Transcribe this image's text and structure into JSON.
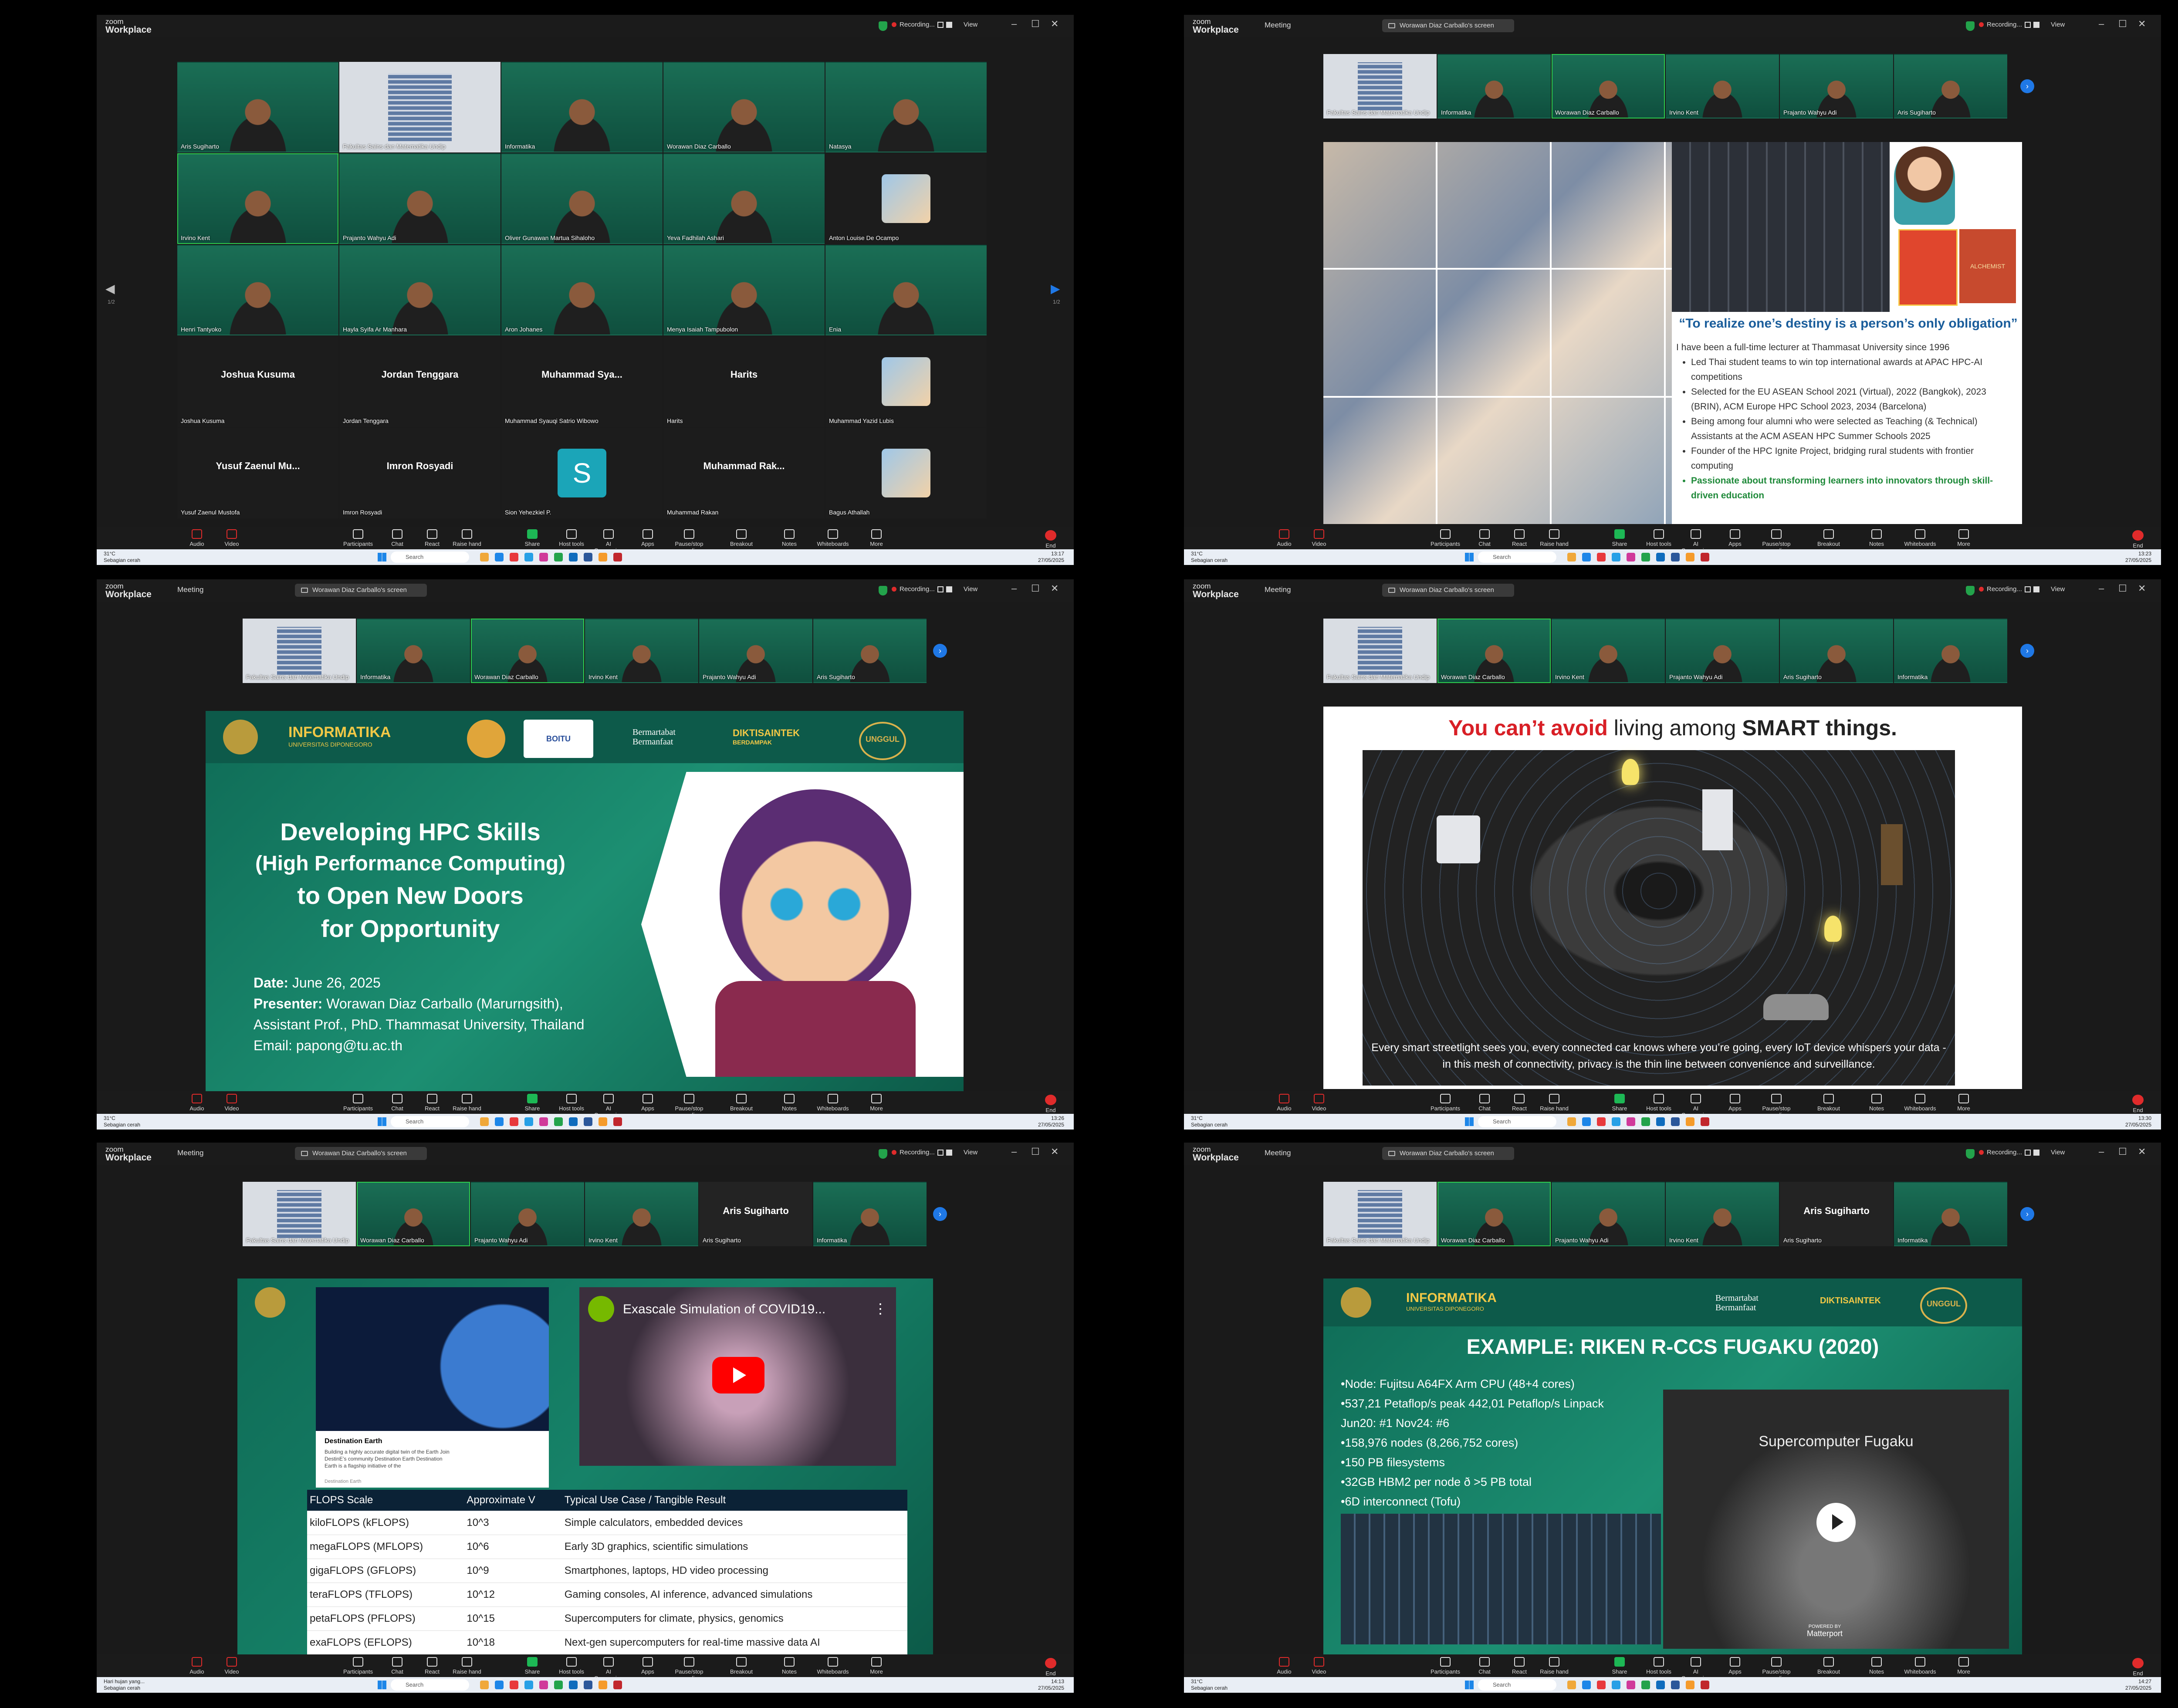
{
  "app": {
    "logo_line1": "zoom",
    "logo_line2": "Workplace",
    "meeting": "Meeting",
    "screen_label": "Worawan Diaz Carballo's screen",
    "recording": "Recording...",
    "view": "View"
  },
  "toolbar": {
    "audio": "Audio",
    "video": "Video",
    "participants": "Participants",
    "chat": "Chat",
    "react": "React",
    "raise": "Raise hand",
    "share": "Share",
    "host": "Host tools",
    "ai": "AI Companion",
    "apps": "Apps",
    "pause": "Pause/stop recording",
    "breakout": "Breakout rooms",
    "notes": "Notes",
    "whiteboards": "Whiteboards",
    "more": "More",
    "end": "End"
  },
  "taskbar": {
    "temp": "31°C",
    "cond": "Sebagian cerah",
    "search": "Search",
    "date": "27/05/2025"
  },
  "panels": [
    {
      "time": "13:17",
      "grid_tiles": [
        {
          "name": "Aris Sugiharto",
          "type": "green"
        },
        {
          "name": "Fakultas Sains dan Matematika Undip",
          "type": "bldg"
        },
        {
          "name": "Informatika",
          "type": "green"
        },
        {
          "name": "Worawan Diaz Carballo",
          "type": "green"
        },
        {
          "name": "Natasya",
          "type": "green"
        },
        {
          "name": "Irvino Kent",
          "type": "green",
          "active": true
        },
        {
          "name": "Prajanto Wahyu Adi",
          "type": "green"
        },
        {
          "name": "Oliver Gunawan Martua Sihaloho",
          "type": "green"
        },
        {
          "name": "Yeva Fadhilah Ashari",
          "type": "green"
        },
        {
          "name": "Anton Louise De Ocampo",
          "type": "dark"
        },
        {
          "name": "Henri Tantyoko",
          "type": "green"
        },
        {
          "name": "Hayla Syifa Ar Manhara",
          "type": "green"
        },
        {
          "name": "Aron Johanes",
          "type": "green"
        },
        {
          "name": "Menya Isaiah Tampubolon",
          "type": "green"
        },
        {
          "name": "Enia",
          "type": "green"
        },
        {
          "name": "Joshua Kusuma",
          "big": "Joshua Kusuma",
          "type": "dark"
        },
        {
          "name": "Jordan Tenggara",
          "big": "Jordan Tenggara",
          "type": "dark"
        },
        {
          "name": "Muhammad Syauqi Satrio Wibowo",
          "big": "Muhammad  Sya...",
          "type": "dark"
        },
        {
          "name": "Harits",
          "big": "Harits",
          "type": "dark"
        },
        {
          "name": "Muhammad Yazid Lubis",
          "type": "dark"
        },
        {
          "name": "Yusuf Zaenul Mustofa",
          "big": "Yusuf  Zaenul  Mu...",
          "type": "dark"
        },
        {
          "name": "Imron Rosyadi",
          "big": "Imron Rosyadi",
          "type": "dark"
        },
        {
          "name": "Sion Yehezkiel P.",
          "letter": "S",
          "type": "dark"
        },
        {
          "name": "Muhammad Rakan",
          "big": "Muhammad  Rak...",
          "type": "dark"
        },
        {
          "name": "Bagus Athallah",
          "type": "dark"
        }
      ],
      "page": "1/2"
    },
    {
      "time": "13:23",
      "strip": [
        "Fakultas Sains dan Matematika Undip",
        "Informatika",
        "Worawan Diaz Carballo",
        "Irvino Kent",
        "Prajanto Wahyu Adi",
        "Aris Sugiharto"
      ],
      "quote": "“To realize one’s destiny is a person’s only obligation”",
      "bio_intro": "I have been a full-time lecturer at Thammasat University since 1996",
      "bullets": [
        "Led Thai student teams to win top international awards at APAC HPC-AI competitions",
        "Selected for the EU ASEAN School 2021 (Virtual), 2022 (Bangkok), 2023 (BRIN), ACM Europe HPC School 2023, 2034 (Barcelona)",
        "Being among four alumni who were selected as Teaching (& Technical) Assistants at the ACM ASEAN HPC Summer Schools 2025",
        "Founder of the HPC Ignite Project, bridging rural students with frontier computing"
      ],
      "bullet_green": "Passionate about transforming learners into innovators through skill-driven education",
      "book_label": "ALCHEMIST"
    },
    {
      "time": "13:26",
      "strip": [
        "Fakultas Sains dan Matematika Undip",
        "Informatika",
        "Worawan Diaz Carballo",
        "Irvino Kent",
        "Prajanto Wahyu Adi",
        "Aris Sugiharto"
      ],
      "logo_text": "INFORMATIKA",
      "logo_sub": "UNIVERSITAS DIPONEGORO",
      "tagline1": "Bermartabat",
      "tagline2": "Bermanfaat",
      "diktis": "DIKTISAINTEK",
      "diktis_sub": "BERDAMPAK",
      "unggul": "UNGGUL",
      "boitu": "BOITU",
      "title1": "Developing HPC  Skills",
      "title2": "(High Performance Computing)",
      "title3": "to Open New Doors",
      "title4": "for Opportunity",
      "date_label": "Date:",
      "date": " June 26, 2025",
      "presenter_label": "Presenter:",
      "presenter": " Worawan Diaz Carballo (Marurngsith),",
      "role": "Assistant Prof., PhD.  Thammasat University, Thailand",
      "email": "Email: papong@tu.ac.th"
    },
    {
      "time": "13:30",
      "strip": [
        "Fakultas Sains dan Matematika Undip",
        "Worawan Diaz Carballo",
        "Irvino Kent",
        "Prajanto Wahyu Adi",
        "Aris Sugiharto",
        "Informatika"
      ],
      "heading_red": "You can’t avoid",
      "heading_mid": " living among ",
      "heading_bold": "SMART things.",
      "caption": "Every smart streetlight sees you, every connected car knows where you’re going, every IoT device whispers your data - in this mesh of connectivity, privacy is the thin line between convenience and surveillance."
    },
    {
      "time": "14:13",
      "weather_override": "Hari hujan yang...",
      "strip": [
        "Fakultas Sains dan Matematika Undip",
        "Worawan Diaz Carballo",
        "Prajanto Wahyu Adi",
        "Irvino Kent",
        "Aris Sugiharto",
        "Informatika"
      ],
      "strip_big": "Aris Sugiharto",
      "card_title": "Destination Earth",
      "card_text": "Building a highly accurate digital twin of the Earth Join DestinE’s community Destination Earth Destination Earth is a flagship initiative of the",
      "card_foot": "Destination Earth",
      "video_title": "Exascale Simulation of COVID19...",
      "table_head": [
        "FLOPS Scale",
        "Approximate V",
        "Typical Use Case / Tangible Result"
      ],
      "table_rows": [
        [
          "kiloFLOPS (kFLOPS)",
          "10^3",
          "Simple calculators, embedded devices"
        ],
        [
          "megaFLOPS (MFLOPS)",
          "10^6",
          "Early 3D graphics, scientific simulations"
        ],
        [
          "gigaFLOPS (GFLOPS)",
          "10^9",
          "Smartphones, laptops, HD video processing"
        ],
        [
          "teraFLOPS (TFLOPS)",
          "10^12",
          "Gaming consoles, AI inference, advanced simulations"
        ],
        [
          "petaFLOPS (PFLOPS)",
          "10^15",
          "Supercomputers for climate, physics, genomics"
        ],
        [
          "exaFLOPS (EFLOPS)",
          "10^18",
          "Next-gen supercomputers for real-time massive data AI"
        ]
      ]
    },
    {
      "time": "14:27",
      "strip": [
        "Fakultas Sains dan Matematika Undip",
        "Worawan Diaz Carballo",
        "Prajanto Wahyu Adi",
        "Irvino Kent",
        "Aris Sugiharto",
        "Informatika"
      ],
      "strip_big": "Aris Sugiharto",
      "logo_text": "INFORMATIKA",
      "logo_sub": "UNIVERSITAS DIPONEGORO",
      "tagline1": "Bermartabat",
      "tagline2": "Bermanfaat",
      "diktis": "DIKTISAINTEK",
      "unggul": "UNGGUL",
      "title": "EXAMPLE: RIKEN R-CCS FUGAKU (2020)",
      "lines": [
        "•Node: Fujitsu A64FX Arm CPU (48+4 cores)",
        "•537,21 Petaflop/s peak 442,01 Petaflop/s Linpack",
        "Jun20: #1 Nov24: #6",
        "•158,976 nodes (8,266,752 cores)",
        "•150 PB filesystems",
        "•32GB HBM2 per node ð >5 PB total",
        "•6D interconnect (Tofu)"
      ],
      "video_caption": "Supercomputer Fugaku",
      "matterport": "Matterport",
      "powered": "POWERED BY"
    }
  ]
}
